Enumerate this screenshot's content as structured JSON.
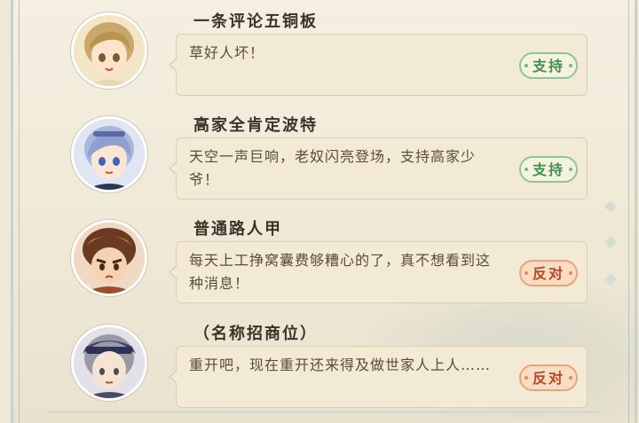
{
  "comments": [
    {
      "name": "一条评论五铜板",
      "text": "草好人坏！",
      "tag": "支持",
      "tag_type": "support",
      "avatar": "blonde-boy-avatar"
    },
    {
      "name": "高家全肯定波特",
      "text": "天空一声巨响，老奴闪亮登场，支持高家少爷！",
      "tag": "支持",
      "tag_type": "support",
      "avatar": "silver-hair-boy-avatar"
    },
    {
      "name": "普通路人甲",
      "text": "每天上工挣窝囊费够糟心的了，真不想看到这种消息！",
      "tag": "反对",
      "tag_type": "oppose",
      "avatar": "armored-warrior-avatar"
    },
    {
      "name": "（名称招商位）",
      "text": "重开吧，现在重开还来得及做世家人上人……",
      "tag": "反对",
      "tag_type": "oppose",
      "avatar": "grey-hair-hat-avatar"
    }
  ],
  "colors": {
    "support": "#3f8f4e",
    "oppose": "#b04a2b",
    "background": "#efe9d8"
  }
}
